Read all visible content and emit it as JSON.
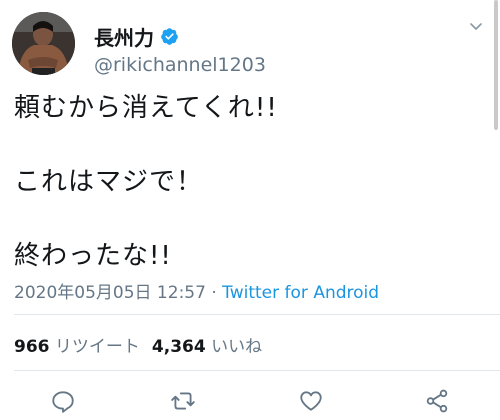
{
  "user": {
    "name": "長州力",
    "handle": "@rikichannel1203",
    "verified": true
  },
  "tweet": {
    "lines": [
      "頼むから消えてくれ!!",
      "これはマジで！",
      "終わったな!!"
    ],
    "timestamp": "2020年05月05日 12:57",
    "separator": " · ",
    "source": "Twitter for Android"
  },
  "stats": {
    "retweets_count": "966",
    "retweets_label": "リツイート",
    "likes_count": "4,364",
    "likes_label": "いいね"
  },
  "icons": {
    "verified": "verified-badge-icon",
    "caret": "chevron-down-icon",
    "reply": "reply-icon",
    "retweet": "retweet-icon",
    "like": "heart-icon",
    "share": "share-icon"
  },
  "colors": {
    "text": "#14171a",
    "secondary": "#657786",
    "link": "#1b95e0",
    "verified": "#1da1f2",
    "divider": "#e1e8ed"
  }
}
